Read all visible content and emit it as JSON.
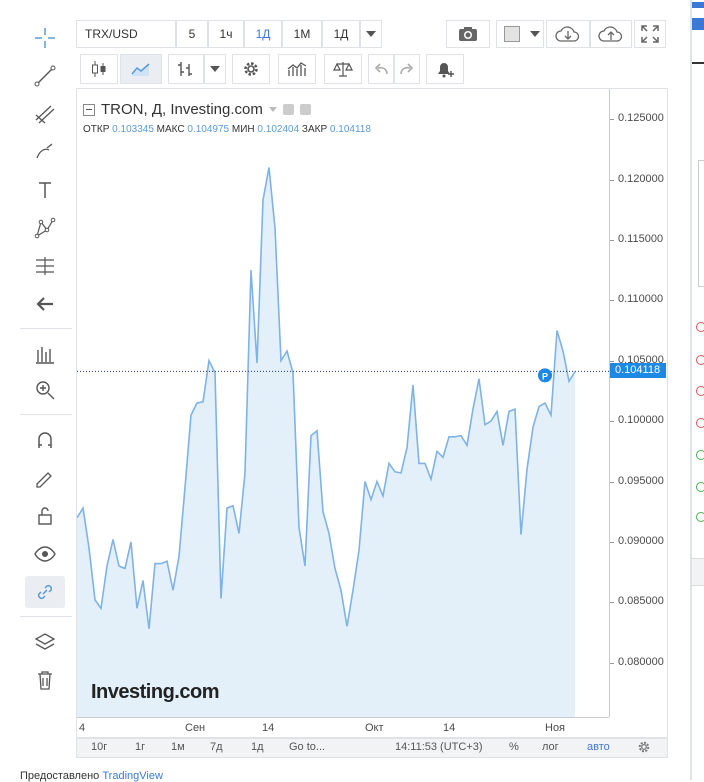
{
  "symbol": "TRX/USD",
  "intervals": [
    "5",
    "1ч",
    "1Д",
    "1М",
    "1Д"
  ],
  "selected_interval": "1Д",
  "legend": {
    "title": "TRON, Д, Investing.com",
    "open_label": "ОТКР",
    "open": "0.103345",
    "high_label": "МАКС",
    "high": "0.104975",
    "low_label": "МИН",
    "low": "0.102404",
    "close_label": "ЗАКР",
    "close": "0.104118"
  },
  "current_price": "0.104118",
  "watermark": "Investing.com",
  "bottom": {
    "ranges": [
      "10г",
      "1г",
      "1м",
      "7д",
      "1д"
    ],
    "goto": "Go to...",
    "time": "14:11:53 (UTC+3)",
    "percent": "%",
    "log": "лог",
    "auto": "авто"
  },
  "footer": {
    "text": "Предоставлено",
    "link": "TradingView"
  },
  "colors": {
    "line": "#7fb2e5",
    "fill": "#e3f0fa",
    "accent": "#3c78d8",
    "price_tag": "#1e88e5"
  },
  "chart_data": {
    "type": "area",
    "y_ticks": [
      "0.125000",
      "0.120000",
      "0.115000",
      "0.110000",
      "0.105000",
      "0.100000",
      "0.095000",
      "0.090000",
      "0.085000",
      "0.080000"
    ],
    "x_ticks": [
      "4",
      "Сен",
      "14",
      "Окт",
      "14",
      "Ноя"
    ],
    "ylim": [
      0.0755,
      0.1275
    ],
    "values": [
      0.092,
      0.0928,
      0.0895,
      0.0852,
      0.0845,
      0.088,
      0.0902,
      0.088,
      0.0878,
      0.09,
      0.0845,
      0.0868,
      0.0828,
      0.0882,
      0.0882,
      0.0884,
      0.086,
      0.0888,
      0.0945,
      0.1005,
      0.1015,
      0.1016,
      0.105,
      0.104,
      0.0853,
      0.0928,
      0.093,
      0.0907,
      0.0957,
      0.1125,
      0.1048,
      0.1183,
      0.121,
      0.116,
      0.105,
      0.1058,
      0.104,
      0.0912,
      0.088,
      0.0988,
      0.0992,
      0.0925,
      0.0907,
      0.0878,
      0.086,
      0.083,
      0.086,
      0.0893,
      0.095,
      0.0935,
      0.095,
      0.0938,
      0.0965,
      0.0958,
      0.0957,
      0.0978,
      0.103,
      0.0965,
      0.0965,
      0.0952,
      0.0975,
      0.097,
      0.0987,
      0.0987,
      0.0988,
      0.098,
      0.101,
      0.1035,
      0.0997,
      0.1,
      0.1008,
      0.098,
      0.1008,
      0.101,
      0.0906,
      0.096,
      0.0995,
      0.1012,
      0.1015,
      0.1005,
      0.1075,
      0.1058,
      0.1033,
      0.1041
    ]
  }
}
